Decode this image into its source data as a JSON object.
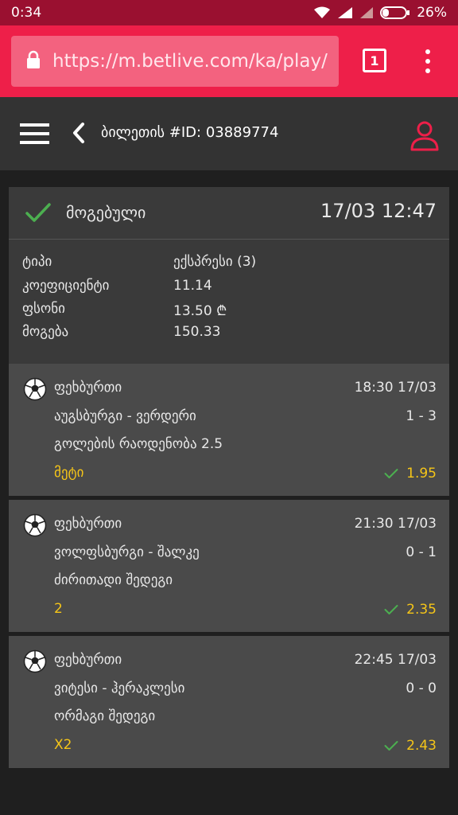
{
  "status_bar": {
    "time": "0:34",
    "battery": "26%"
  },
  "browser": {
    "url": "https://m.betlive.com/ka/play/",
    "tab_count": "1"
  },
  "header": {
    "title": "ბილეთის #ID: 03889774"
  },
  "summary": {
    "status": "მოგებული",
    "datetime": "17/03 12:47",
    "rows": [
      {
        "label": "ტიპი",
        "value": "ექსპრესი (3)"
      },
      {
        "label": "კოეფიციენტი",
        "value": "11.14"
      },
      {
        "label": "ფსონი",
        "value": "13.50 ₾"
      },
      {
        "label": "მოგება",
        "value": "150.33"
      }
    ]
  },
  "events": [
    {
      "sport": "ფეხბურთი",
      "time": "18:30 17/03",
      "teams": "აუგსბურგი - ვერდერი",
      "score": "1 - 3",
      "market": "გოლების რაოდენობა 2.5",
      "pick": "მეტი",
      "odd": "1.95"
    },
    {
      "sport": "ფეხბურთი",
      "time": "21:30 17/03",
      "teams": "ვოლფსბურგი - შალკე",
      "score": "0 - 1",
      "market": "ძირითადი შედეგი",
      "pick": "2",
      "odd": "2.35"
    },
    {
      "sport": "ფეხბურთი",
      "time": "22:45 17/03",
      "teams": "ვიტესი - ჰერაკლესი",
      "score": "0 - 0",
      "market": "ორმაგი შედეგი",
      "pick": "X2",
      "odd": "2.43"
    }
  ],
  "colors": {
    "browser_bar": "#ee1f49",
    "status_bar": "#9a1030",
    "win_green": "#4caf50",
    "pick_yellow": "#f5c518"
  }
}
